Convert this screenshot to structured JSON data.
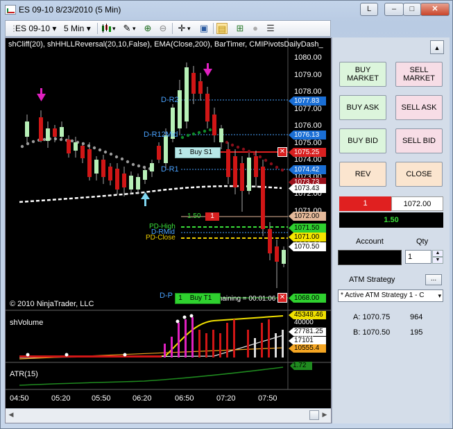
{
  "window": {
    "title": "ES 09-10  8/23/2010 (5 Min)",
    "btn_l": "L",
    "btn_min": "–",
    "btn_max": "□",
    "btn_close": "✕"
  },
  "toolbar": {
    "instrument": "ES 09-10",
    "interval": "5 Min",
    "dropdown_arrow": "▾"
  },
  "chart": {
    "indicator_header": "shCliff(20), shHHLLReversal(20,10,False), EMA(Close,200), BarTimer, CMIPivotsDailyDash_",
    "copyright": "© 2010 NinjaTrader, LLC",
    "bar_timer": "maining = 00:01:06",
    "price_ticks": [
      "1080.00",
      "1079.00",
      "1078.00",
      "1077.00",
      "1076.00",
      "1075.00",
      "1074.00",
      "1073.00",
      "1072.00",
      "1071.00",
      "1070.00",
      "1069.00"
    ],
    "price_tags": [
      {
        "text": "1077.83",
        "bg": "#1a6fd6",
        "fg": "#ffffff"
      },
      {
        "text": "1076.13",
        "bg": "#1a6fd6",
        "fg": "#ffffff"
      },
      {
        "text": "1075.25",
        "bg": "#d92020",
        "fg": "#ffffff"
      },
      {
        "text": "1074.42",
        "bg": "#1a6fd6",
        "fg": "#ffffff"
      },
      {
        "text": "1073.73",
        "bg": "#9a0f1a",
        "fg": "#ffffff"
      },
      {
        "text": "1073.43",
        "bg": "#ffffff",
        "fg": "#000000"
      },
      {
        "text": "1072.00",
        "bg": "#e4b99a",
        "fg": "#000000"
      },
      {
        "text": "1071.50",
        "bg": "#2fd12f",
        "fg": "#000000"
      },
      {
        "text": "1071.00",
        "bg": "#f5e500",
        "fg": "#000000"
      },
      {
        "text": "1070.50",
        "bg": "#ffffff",
        "fg": "#000000"
      },
      {
        "text": "1068.00",
        "bg": "#2fd12f",
        "fg": "#000000"
      }
    ],
    "pivot_labels": {
      "r2": "D-R2",
      "r12mid": "D-R12Mid",
      "r1": "D-R1",
      "pdhigh": "PD-High",
      "rmid": "D-RMid",
      "pdclose": "PD-Close",
      "dp": "D-P"
    },
    "orders": {
      "buy_s1": "Buy S1",
      "buy_s1_qty": "1",
      "buy_t1": "Buy T1",
      "buy_t1_qty": "1",
      "stop_qty_price": "1.50",
      "stop_qty": "1"
    },
    "volume_panel": {
      "title": "shVolume",
      "ticks": [
        "40000",
        "20000"
      ],
      "tags": [
        {
          "text": "45348.46",
          "bg": "#f0e000"
        },
        {
          "text": "27781.25",
          "bg": "#ffffff"
        },
        {
          "text": "17101",
          "bg": "#ffffff"
        },
        {
          "text": "10555.4",
          "bg": "#f5a623"
        }
      ]
    },
    "atr_panel": {
      "title": "ATR(15)",
      "tag": "1.72"
    },
    "time_labels": [
      "04:50",
      "05:20",
      "05:50",
      "06:20",
      "06:50",
      "07:20",
      "07:50"
    ]
  },
  "order_panel": {
    "buy_market": "BUY\nMARKET",
    "sell_market": "SELL\nMARKET",
    "buy_ask": "BUY ASK",
    "sell_ask": "SELL ASK",
    "buy_bid": "BUY BID",
    "sell_bid": "SELL BID",
    "rev": "REV",
    "close": "CLOSE",
    "position_qty": "1",
    "position_price": "1072.00",
    "pnl": "1.50",
    "account_label": "Account",
    "qty_label": "Qty",
    "qty_value": "1",
    "atm_label": "ATM Strategy",
    "atm_more": "...",
    "atm_selected": "* Active ATM Strategy 1 - C",
    "ask_label": "A: 1070.75",
    "ask_size": "964",
    "bid_label": "B: 1070.50",
    "bid_size": "195"
  }
}
